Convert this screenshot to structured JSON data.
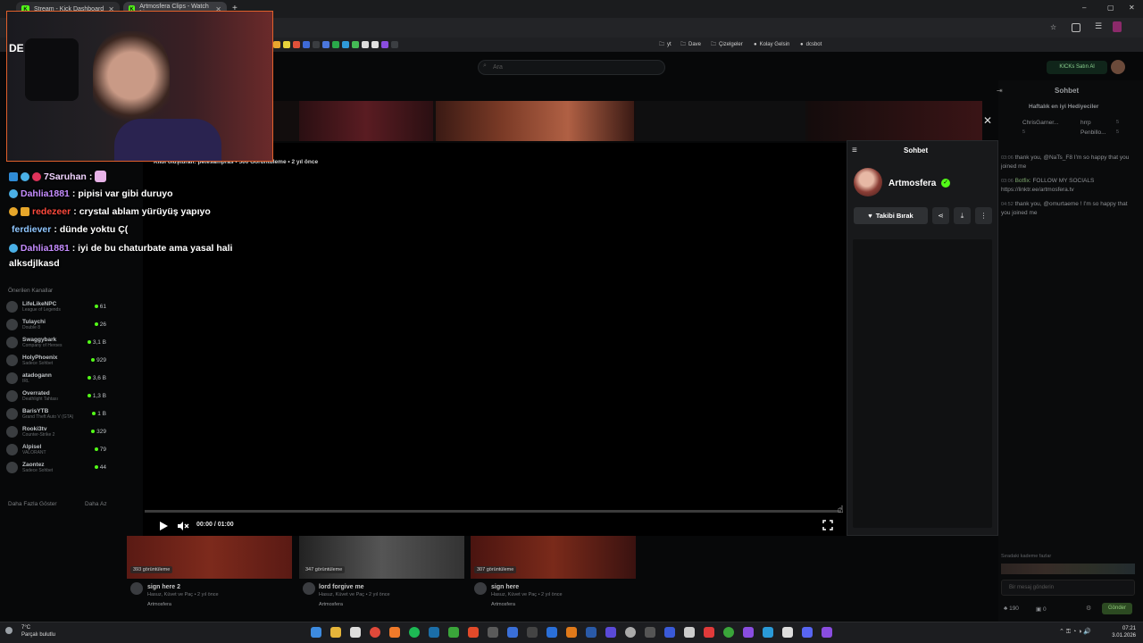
{
  "browser": {
    "tabs": [
      {
        "label": "Stream - Kick Dashboard"
      },
      {
        "label": "Artmosfera Clips - Watch Live ..."
      }
    ],
    "bookmarks": [
      "yt",
      "Dave",
      "Çizelgeler",
      "Kolay Gelsin",
      "dcsbot"
    ]
  },
  "header": {
    "search_placeholder": "Ara",
    "buy_kicks_label": "KICKs Satın Al"
  },
  "left_sidebar": {
    "recommended_title": "Önerilen Kanallar",
    "channels": [
      {
        "name": "LifeLikeNPC",
        "category": "League of Legends",
        "viewers": "61"
      },
      {
        "name": "Tulaychi",
        "category": "Double 8",
        "viewers": "26"
      },
      {
        "name": "Swaggybark",
        "category": "Company of Heroes",
        "viewers": "3,1 B"
      },
      {
        "name": "HolyPhoenix",
        "category": "Sadece Sohbet",
        "viewers": "929"
      },
      {
        "name": "atadogann",
        "category": "IRL",
        "viewers": "3,6 B"
      },
      {
        "name": "Overrated",
        "category": "Deathlight Tahtası",
        "viewers": "1,3 B"
      },
      {
        "name": "BarisYTB",
        "category": "Grand Theft Auto V (GTA)",
        "viewers": "1 B"
      },
      {
        "name": "Rooki3tv",
        "category": "Counter-Strike 2",
        "viewers": "329"
      },
      {
        "name": "Alpisel",
        "category": "VALORANT",
        "viewers": "79"
      },
      {
        "name": "Zaontez",
        "category": "Sadece Sohbet",
        "viewers": "44"
      }
    ],
    "show_more": "Daha Fazla Göster",
    "show_less": "Daha Az"
  },
  "overlay_chat": [
    {
      "user": "7Saruhan",
      "user_color": "#f0d3ff",
      "text": ""
    },
    {
      "user": "Dahlia1881",
      "user_color": "#c58cff",
      "text": "pipisi var gibi duruyo"
    },
    {
      "user": "redezeer",
      "user_color": "#ff4a3d",
      "text": "crystal ablam yürüyüş yapıyo"
    },
    {
      "user": "ferdiever",
      "user_color": "#8fc6ff",
      "text": "dünde yoktu Ç("
    },
    {
      "user": "Dahlia1881",
      "user_color": "#c58cff",
      "text": "iyi de bu chaturbate ama yasal hali alksdjlkasd"
    }
  ],
  "player": {
    "meta": "Klibi oluşturan: petesampras • 500 Görüntüleme • 2 yıl önce",
    "time_current": "00:00",
    "time_total": "01:00"
  },
  "clip_panel": {
    "title": "Sohbet",
    "channel_name": "Artmosfera",
    "unfollow_label": "Takibi Bırak"
  },
  "right_chat": {
    "title": "Sohbet",
    "gifters_title": "Haftalık en iyi Hediyeciler",
    "gifters": [
      {
        "name": "ChrisGarner...",
        "count": "5"
      },
      {
        "name": "hrrp",
        "count": "5"
      },
      {
        "name": "Penbillo...",
        "count": "5"
      }
    ],
    "messages": [
      {
        "time": "03:06",
        "user": "",
        "text": "thank you, @NaTs_F8 I'm so happy that you joined me"
      },
      {
        "time": "03:06",
        "user": "Botfix:",
        "text": "FOLLOW MY SOCIALS https://linktr.ee/artmosfera.tv"
      },
      {
        "time": "04:52",
        "user": "",
        "text": "thank you, @omurtaeme ! I'm so happy that you joined me"
      }
    ],
    "emote_label": "Sıradaki kademe fazlar",
    "input_placeholder": "Bir mesaj gönderin",
    "send_label": "Gönder",
    "points": "190",
    "other_count": "0"
  },
  "below_clips": [
    {
      "views": "393 görüntüleme",
      "title": "sign here 2",
      "sub": "Hasuz, Küvet ve Paç • 2 yıl önce",
      "channel": "Artmosfera"
    },
    {
      "views": "347 görüntüleme",
      "title": "lord forgive me",
      "sub": "Hasuz, Küvet ve Paç • 2 yıl önce",
      "channel": "Artmosfera"
    },
    {
      "views": "307 görüntüleme",
      "title": "sign here",
      "sub": "Hasuz, Küvet ve Paç • 2 yıl önce",
      "channel": "Artmosfera"
    }
  ],
  "taskbar": {
    "weather_temp": "7°C",
    "weather_desc": "Parçalı bulutlu",
    "time": "07:21",
    "date": "3.01.2026"
  },
  "colors": {
    "kick_green": "#53fc18",
    "webcam_border": "#e0602b"
  }
}
